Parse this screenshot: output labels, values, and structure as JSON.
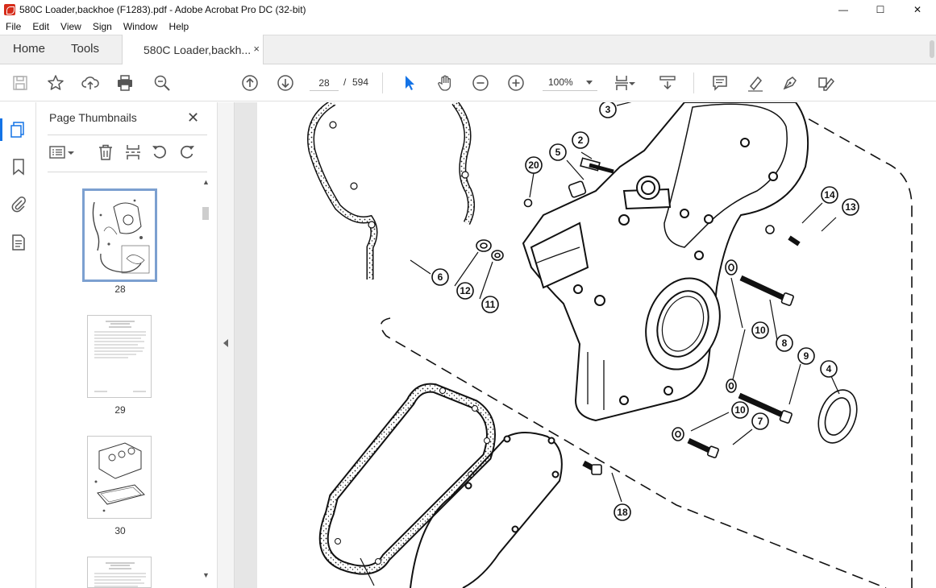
{
  "window": {
    "title": "580C Loader,backhoe (F1283).pdf - Adobe Acrobat Pro DC (32-bit)",
    "controls": {
      "minimize": "—",
      "maximize": "☐",
      "close": "✕"
    }
  },
  "menu": [
    "File",
    "Edit",
    "View",
    "Sign",
    "Window",
    "Help"
  ],
  "tabs": {
    "home": "Home",
    "tools": "Tools",
    "document": "580C Loader,backh...",
    "close": "×"
  },
  "toolbar": {
    "page_current": "28",
    "page_separator": "/",
    "page_total": "594",
    "zoom": "100%",
    "icons": [
      "save-icon",
      "star-icon",
      "cloud-upload-icon",
      "print-icon",
      "zoom-search-icon",
      "page-up-icon",
      "page-down-icon",
      "select-pointer-icon",
      "hand-icon",
      "zoom-out-icon",
      "zoom-in-icon",
      "fit-page-icon",
      "scroll-mode-icon",
      "comment-icon",
      "highlight-pen-icon",
      "draw-pen-icon",
      "fill-sign-icon"
    ],
    "accent": "#1473e6"
  },
  "thumbnails_panel": {
    "title": "Page Thumbnails",
    "close": "✕",
    "pages": [
      {
        "label": "28",
        "selected": true
      },
      {
        "label": "29",
        "selected": false
      },
      {
        "label": "30",
        "selected": false
      },
      {
        "label": "",
        "selected": false
      }
    ]
  },
  "diagram": {
    "callouts": [
      "3",
      "2",
      "5",
      "20",
      "6",
      "12",
      "11",
      "14",
      "13",
      "10",
      "8",
      "9",
      "4",
      "10",
      "7",
      "18"
    ]
  }
}
